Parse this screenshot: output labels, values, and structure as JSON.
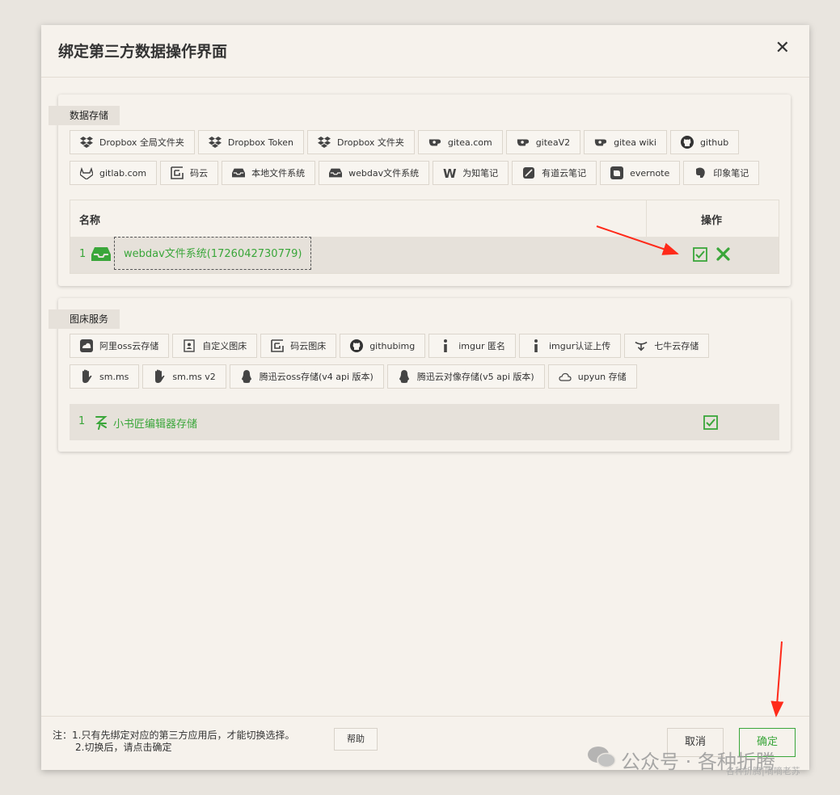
{
  "dialog": {
    "title": "绑定第三方数据操作界面",
    "close": "✕"
  },
  "storage": {
    "tag": "数据存储",
    "row1": [
      {
        "label": "Dropbox 全局文件夹",
        "icon": "dropbox-icon"
      },
      {
        "label": "Dropbox Token",
        "icon": "dropbox-icon"
      },
      {
        "label": "Dropbox 文件夹",
        "icon": "dropbox-icon"
      },
      {
        "label": "gitea.com",
        "icon": "gitea-icon"
      },
      {
        "label": "giteaV2",
        "icon": "gitea-icon"
      },
      {
        "label": "gitea wiki",
        "icon": "gitea-icon"
      },
      {
        "label": "github",
        "icon": "github-icon"
      }
    ],
    "row2": [
      {
        "label": "gitlab.com",
        "icon": "gitlab-icon"
      },
      {
        "label": "码云",
        "icon": "gitee-icon"
      },
      {
        "label": "本地文件系统",
        "icon": "inbox-icon"
      },
      {
        "label": "webdav文件系统",
        "icon": "inbox-icon"
      },
      {
        "label": "为知笔记",
        "icon": "wiz-icon"
      },
      {
        "label": "有道云笔记",
        "icon": "youdao-icon"
      },
      {
        "label": "evernote",
        "icon": "evernote-icon"
      },
      {
        "label": "印象笔记",
        "icon": "elephant-icon"
      }
    ],
    "table": {
      "col_name": "名称",
      "col_op": "操作",
      "rows": [
        {
          "index": "1",
          "name": "webdav文件系统(1726042730779)"
        }
      ]
    }
  },
  "image": {
    "tag": "图床服务",
    "row1": [
      {
        "label": "阿里oss云存储",
        "icon": "aliyun-icon"
      },
      {
        "label": "自定义图床",
        "icon": "contact-icon"
      },
      {
        "label": "码云图床",
        "icon": "gitee-icon"
      },
      {
        "label": "githubimg",
        "icon": "github-icon"
      },
      {
        "label": "imgur 匿名",
        "icon": "imgur-icon"
      },
      {
        "label": "imgur认证上传",
        "icon": "imgur-icon"
      },
      {
        "label": "七牛云存储",
        "icon": "qiniu-icon"
      }
    ],
    "row2": [
      {
        "label": "sm.ms",
        "icon": "hand-icon"
      },
      {
        "label": "sm.ms v2",
        "icon": "hand-icon"
      },
      {
        "label": "腾迅云oss存储(v4 api 版本)",
        "icon": "qq-icon"
      },
      {
        "label": "腾迅云对像存储(v5 api 版本)",
        "icon": "qq-icon"
      },
      {
        "label": "upyun 存储",
        "icon": "cloud-icon"
      }
    ],
    "rows": [
      {
        "index": "1",
        "name": "小书匠编辑器存储"
      }
    ]
  },
  "footer": {
    "note_line1": "注：1.只有先绑定对应的第三方应用后，才能切换选择。",
    "note_line2": "2.切换后，请点击确定",
    "help": "帮助",
    "cancel": "取消",
    "ok": "确定"
  },
  "watermark": {
    "main": "公众号 · 各种折腾",
    "sub": "各种折腾|嘀嘀老苏"
  },
  "colors": {
    "accent": "#3aa63a",
    "arrow": "#ff2a1a",
    "bg": "#f6f2ec"
  }
}
